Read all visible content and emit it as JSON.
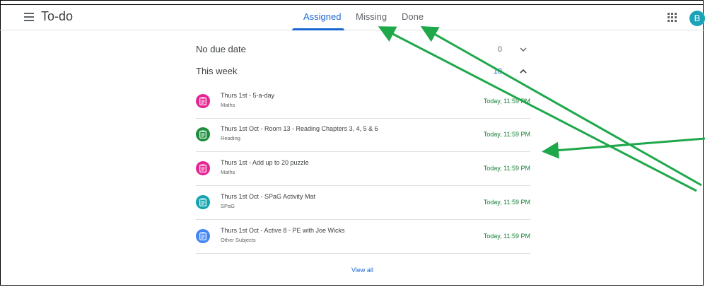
{
  "header": {
    "title": "To-do",
    "tabs": [
      {
        "label": "Assigned",
        "active": true
      },
      {
        "label": "Missing",
        "active": false
      },
      {
        "label": "Done",
        "active": false
      }
    ],
    "avatar_letter": "B"
  },
  "sections": [
    {
      "label": "No due date",
      "count": "0",
      "expanded": false
    },
    {
      "label": "This week",
      "count": "10",
      "expanded": true
    }
  ],
  "items": [
    {
      "title": "Thurs 1st - 5-a-day",
      "subject": "Maths",
      "due": "Today, 11:59 PM",
      "color": "#e52592"
    },
    {
      "title": "Thurs 1st Oct - Room 13 - Reading Chapters 3, 4, 5 & 6",
      "subject": "Reading",
      "due": "Today, 11:59 PM",
      "color": "#1e8e3e"
    },
    {
      "title": "Thurs 1st - Add up to 20 puzzle",
      "subject": "Maths",
      "due": "Today, 11:59 PM",
      "color": "#e52592"
    },
    {
      "title": "Thurs 1st Oct - SPaG Activity Mat",
      "subject": "SPaG",
      "due": "Today, 11:59 PM",
      "color": "#12a4af"
    },
    {
      "title": "Thurs 1st Oct - Active 8 - PE with Joe Wicks",
      "subject": "Other Subjects",
      "due": "Today, 11:59 PM",
      "color": "#4285f4"
    }
  ],
  "view_all": "View all",
  "colors": {
    "accent": "#1967d2",
    "due": "#188038",
    "annotation_arrow": "#1ea84a"
  }
}
